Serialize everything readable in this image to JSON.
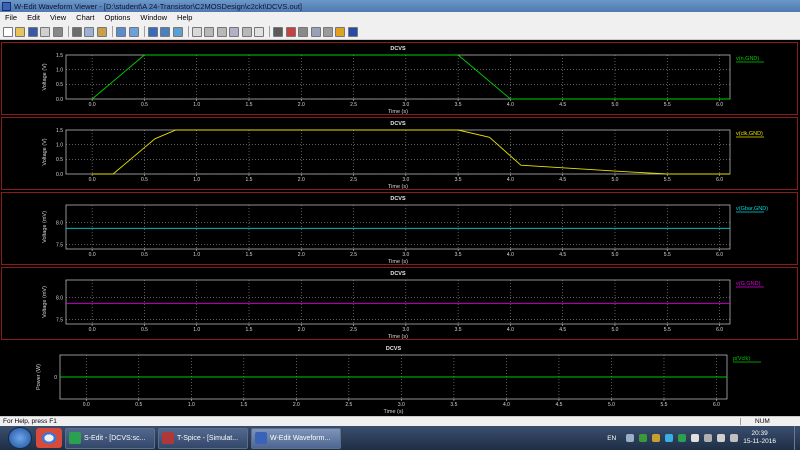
{
  "window": {
    "title": "W-Edit Waveform Viewer - [D:\\student\\A 24-Transistor\\C2MOSDesign\\c2ckt\\DCVS.out]"
  },
  "menu": [
    {
      "label": "File"
    },
    {
      "label": "Edit"
    },
    {
      "label": "View"
    },
    {
      "label": "Chart"
    },
    {
      "label": "Options"
    },
    {
      "label": "Window"
    },
    {
      "label": "Help"
    }
  ],
  "toolbar": {
    "buttons": [
      {
        "name": "new-icon",
        "color": "#ffffff"
      },
      {
        "name": "open-icon",
        "color": "#e8c35a"
      },
      {
        "name": "save-icon",
        "color": "#3a5aa8"
      },
      {
        "name": "print-preview-icon",
        "color": "#d0d0d0"
      },
      {
        "name": "print-icon",
        "color": "#888888"
      },
      {
        "sep": true
      },
      {
        "name": "cut-icon",
        "color": "#6c6c6c"
      },
      {
        "name": "copy-icon",
        "color": "#9ab0d8"
      },
      {
        "name": "paste-icon",
        "color": "#c9a04a"
      },
      {
        "sep": true
      },
      {
        "name": "chart-view-icon",
        "color": "#5a8ad0"
      },
      {
        "name": "zoom-fit-icon",
        "color": "#6ea0d8"
      },
      {
        "sep": true
      },
      {
        "name": "home-icon",
        "color": "#3a6ab8"
      },
      {
        "name": "expand-icon",
        "color": "#4a80c0"
      },
      {
        "name": "grid-icon",
        "color": "#5aa0d0"
      },
      {
        "sep": true
      },
      {
        "name": "trace-icon",
        "color": "#d8d8d8"
      },
      {
        "name": "tile-icon",
        "color": "#b8b8b8"
      },
      {
        "name": "cascade-icon",
        "color": "#b8b8b8"
      },
      {
        "name": "arrange-icon",
        "color": "#b0b0c8"
      },
      {
        "name": "overlay-icon",
        "color": "#b8b8b8"
      },
      {
        "name": "label-icon",
        "color": "#e0e0e0"
      },
      {
        "sep": true
      },
      {
        "name": "cursor-icon",
        "color": "#5a5a5a"
      },
      {
        "name": "measure-icon",
        "color": "#c84040"
      },
      {
        "name": "step-icon",
        "color": "#8a8a8a"
      },
      {
        "name": "pause-icon",
        "color": "#9aa0b8"
      },
      {
        "name": "play-icon",
        "color": "#9a9a9a"
      },
      {
        "name": "simulate-icon",
        "color": "#e0a020"
      },
      {
        "name": "book-icon",
        "color": "#2a4aa8"
      }
    ]
  },
  "panels": [
    {
      "title": "DCVS",
      "ylabel": "Voltage (V)",
      "xlabel": "Time (s)",
      "legend": "v(n,GND)",
      "color": "#00d000",
      "border": "#8a1b1b"
    },
    {
      "title": "DCVS",
      "ylabel": "Voltage (V)",
      "xlabel": "Time (s)",
      "legend": "v(clk,GND)",
      "color": "#e8e000",
      "border": "#8a1b1b"
    },
    {
      "title": "DCVS",
      "ylabel": "Voltage (mV)",
      "xlabel": "Time (s)",
      "legend": "v(Gbar,GND)",
      "color": "#00d8d8",
      "border": "#8a1b1b"
    },
    {
      "title": "DCVS",
      "ylabel": "Voltage (mV)",
      "xlabel": "Time (s)",
      "legend": "v(G,GND)",
      "color": "#e000e0",
      "border": "#8a1b1b"
    },
    {
      "title": "DCVS",
      "ylabel": "Power (W)",
      "xlabel": "Time (s)",
      "legend": "p(Vclk)",
      "color": "#00c800",
      "border": "#000000"
    }
  ],
  "chart_data": [
    {
      "type": "line",
      "title": "DCVS",
      "xlabel": "Time (s)",
      "ylabel": "Voltage (V)",
      "xlim": [
        -0.25,
        6.1
      ],
      "ylim": [
        0,
        1.5
      ],
      "xticks": [
        "0.0",
        "0.5",
        "1.0",
        "1.5",
        "2.0",
        "2.5",
        "3.0",
        "3.5",
        "4.0",
        "4.5",
        "5.0",
        "5.5",
        "6.0"
      ],
      "yticks": [
        "0.0",
        "0.5",
        "1.0",
        "1.5"
      ],
      "series": [
        {
          "name": "v(n,GND)",
          "x": [
            0,
            0.5,
            3.5,
            4.0,
            6.1
          ],
          "y": [
            0,
            1.5,
            1.5,
            0,
            0
          ]
        }
      ]
    },
    {
      "type": "line",
      "title": "DCVS",
      "xlabel": "Time (s)",
      "ylabel": "Voltage (V)",
      "xlim": [
        -0.25,
        6.1
      ],
      "ylim": [
        0,
        1.5
      ],
      "xticks": [
        "0.0",
        "0.5",
        "1.0",
        "1.5",
        "2.0",
        "2.5",
        "3.0",
        "3.5",
        "4.0",
        "4.5",
        "5.0",
        "5.5",
        "6.0"
      ],
      "yticks": [
        "0.0",
        "0.5",
        "1.0",
        "1.5"
      ],
      "series": [
        {
          "name": "v(clk,GND)",
          "x": [
            0,
            0.2,
            0.6,
            0.8,
            3.5,
            3.8,
            4.1,
            5.0,
            5.5,
            6.1
          ],
          "y": [
            0,
            0,
            1.2,
            1.5,
            1.5,
            1.25,
            0.3,
            0.1,
            0,
            0
          ]
        }
      ]
    },
    {
      "type": "line",
      "title": "DCVS",
      "xlabel": "Time (s)",
      "ylabel": "Voltage (mV)",
      "xlim": [
        -0.25,
        6.1
      ],
      "ylim": [
        7.4,
        8.4
      ],
      "xticks": [
        "0.0",
        "0.5",
        "1.0",
        "1.5",
        "2.0",
        "2.5",
        "3.0",
        "3.5",
        "4.0",
        "4.5",
        "5.0",
        "5.5",
        "6.0"
      ],
      "yticks": [
        "7.5",
        "8.0"
      ],
      "series": [
        {
          "name": "v(Gbar,GND)",
          "x": [
            -0.25,
            6.1
          ],
          "y": [
            7.87,
            7.87
          ]
        }
      ]
    },
    {
      "type": "line",
      "title": "DCVS",
      "xlabel": "Time (s)",
      "ylabel": "Voltage (mV)",
      "xlim": [
        -0.25,
        6.1
      ],
      "ylim": [
        7.4,
        8.4
      ],
      "xticks": [
        "0.0",
        "0.5",
        "1.0",
        "1.5",
        "2.0",
        "2.5",
        "3.0",
        "3.5",
        "4.0",
        "4.5",
        "5.0",
        "5.5",
        "6.0"
      ],
      "yticks": [
        "7.5",
        "8.0"
      ],
      "series": [
        {
          "name": "v(G,GND)",
          "x": [
            -0.25,
            6.1
          ],
          "y": [
            7.87,
            7.87
          ]
        }
      ]
    },
    {
      "type": "line",
      "title": "DCVS",
      "xlabel": "Time (s)",
      "ylabel": "Power (W)",
      "xlim": [
        -0.25,
        6.1
      ],
      "ylim": [
        -1,
        1
      ],
      "xticks": [
        "0.0",
        "0.5",
        "1.0",
        "1.5",
        "2.0",
        "2.5",
        "3.0",
        "3.5",
        "4.0",
        "4.5",
        "5.0",
        "5.5",
        "6.0"
      ],
      "yticks": [
        "0"
      ],
      "series": [
        {
          "name": "p(Vclk)",
          "x": [
            -0.25,
            6.1
          ],
          "y": [
            0,
            0
          ]
        }
      ]
    }
  ],
  "status": {
    "message": "For Help, press F1",
    "num": "NUM"
  },
  "taskbar": {
    "apps": [
      {
        "label": "S-Edit - [DCVS:sc...",
        "color": "#2aa050"
      },
      {
        "label": "T-Spice - [Simulat...",
        "color": "#b03838"
      },
      {
        "label": "W-Edit Waveform...",
        "color": "#3a62b6",
        "active": true
      }
    ],
    "lang": "EN",
    "time": "20:39",
    "date": "15-11-2016"
  }
}
